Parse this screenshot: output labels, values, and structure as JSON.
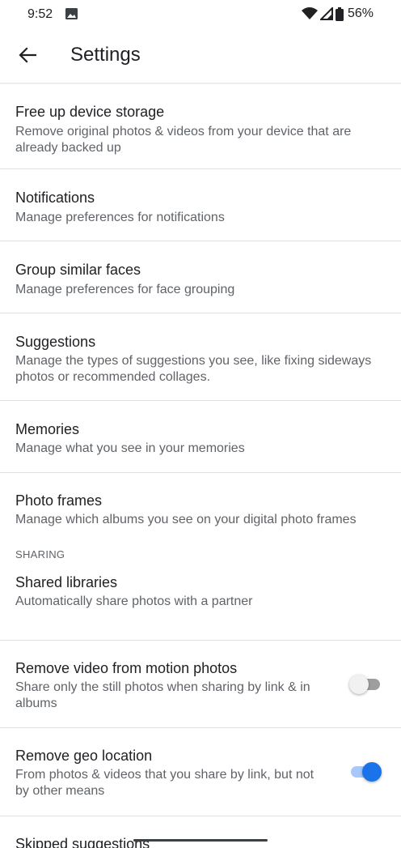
{
  "status": {
    "time": "9:52",
    "battery": "56%"
  },
  "header": {
    "title": "Settings",
    "back_icon": "arrow-back-icon"
  },
  "rows": [
    {
      "title": "Free up device storage",
      "subtitle": "Remove original photos & videos from your device that are already backed up"
    },
    {
      "title": "Notifications",
      "subtitle": "Manage preferences for notifications"
    },
    {
      "title": "Group similar faces",
      "subtitle": "Manage preferences for face grouping"
    },
    {
      "title": "Suggestions",
      "subtitle": "Manage the types of suggestions you see, like fixing sideways photos or recommended collages."
    },
    {
      "title": "Memories",
      "subtitle": "Manage what you see in your memories"
    },
    {
      "title": "Photo frames",
      "subtitle": "Manage which albums you see on your digital photo frames"
    }
  ],
  "sharing": {
    "header": "SHARING",
    "rows": [
      {
        "title": "Shared libraries",
        "subtitle": "Automatically share photos with a partner"
      },
      {
        "title": "Remove video from motion photos",
        "subtitle": "Share only the still photos when sharing by link & in albums",
        "toggle_on": false
      },
      {
        "title": "Remove geo location",
        "subtitle": "From photos & videos that you share by link, but not by other means",
        "toggle_on": true
      }
    ],
    "cut_off_title": "Skipped suggestions"
  },
  "colors": {
    "accent": "#1a73e8",
    "accent_track": "#a8c7fa",
    "toggle_off_thumb": "#f1f1f1",
    "toggle_off_track": "#9e9e9e"
  }
}
